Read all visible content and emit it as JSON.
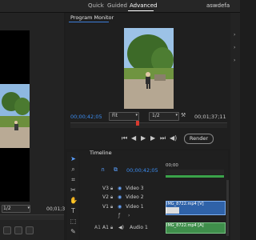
{
  "top": {
    "modes": [
      "Quick",
      "Guided",
      "Advanced"
    ],
    "project_name": "aswdefa"
  },
  "left": {
    "dropdown": "1/2",
    "timecode": "00;01;3"
  },
  "program_monitor": {
    "title": "Program Monitor",
    "current_timecode": "00;00;42;05",
    "fit": "Fit",
    "resolution": "1/2",
    "duration": "00;01;37;11",
    "render_label": "Render"
  },
  "timeline": {
    "title": "Timeline",
    "timecode": "00;00;42;05",
    "ruler_timecode": "00;00",
    "tracks": [
      {
        "id": "V3",
        "name": "Video 3"
      },
      {
        "id": "V2",
        "name": "Video 2"
      },
      {
        "id": "V1",
        "name": "Video 1"
      },
      {
        "id": "A1",
        "name": "Audio 1"
      }
    ],
    "video_clip_label": "IMG_8722.mp4 [V]",
    "audio_clip_label": "IMG_8722.mp4 [A]"
  },
  "colors": {
    "accent": "#3b8cf0",
    "playhead": "#d83a2f",
    "video_clip": "#2f62a8",
    "audio_clip": "#3f8e4b"
  }
}
